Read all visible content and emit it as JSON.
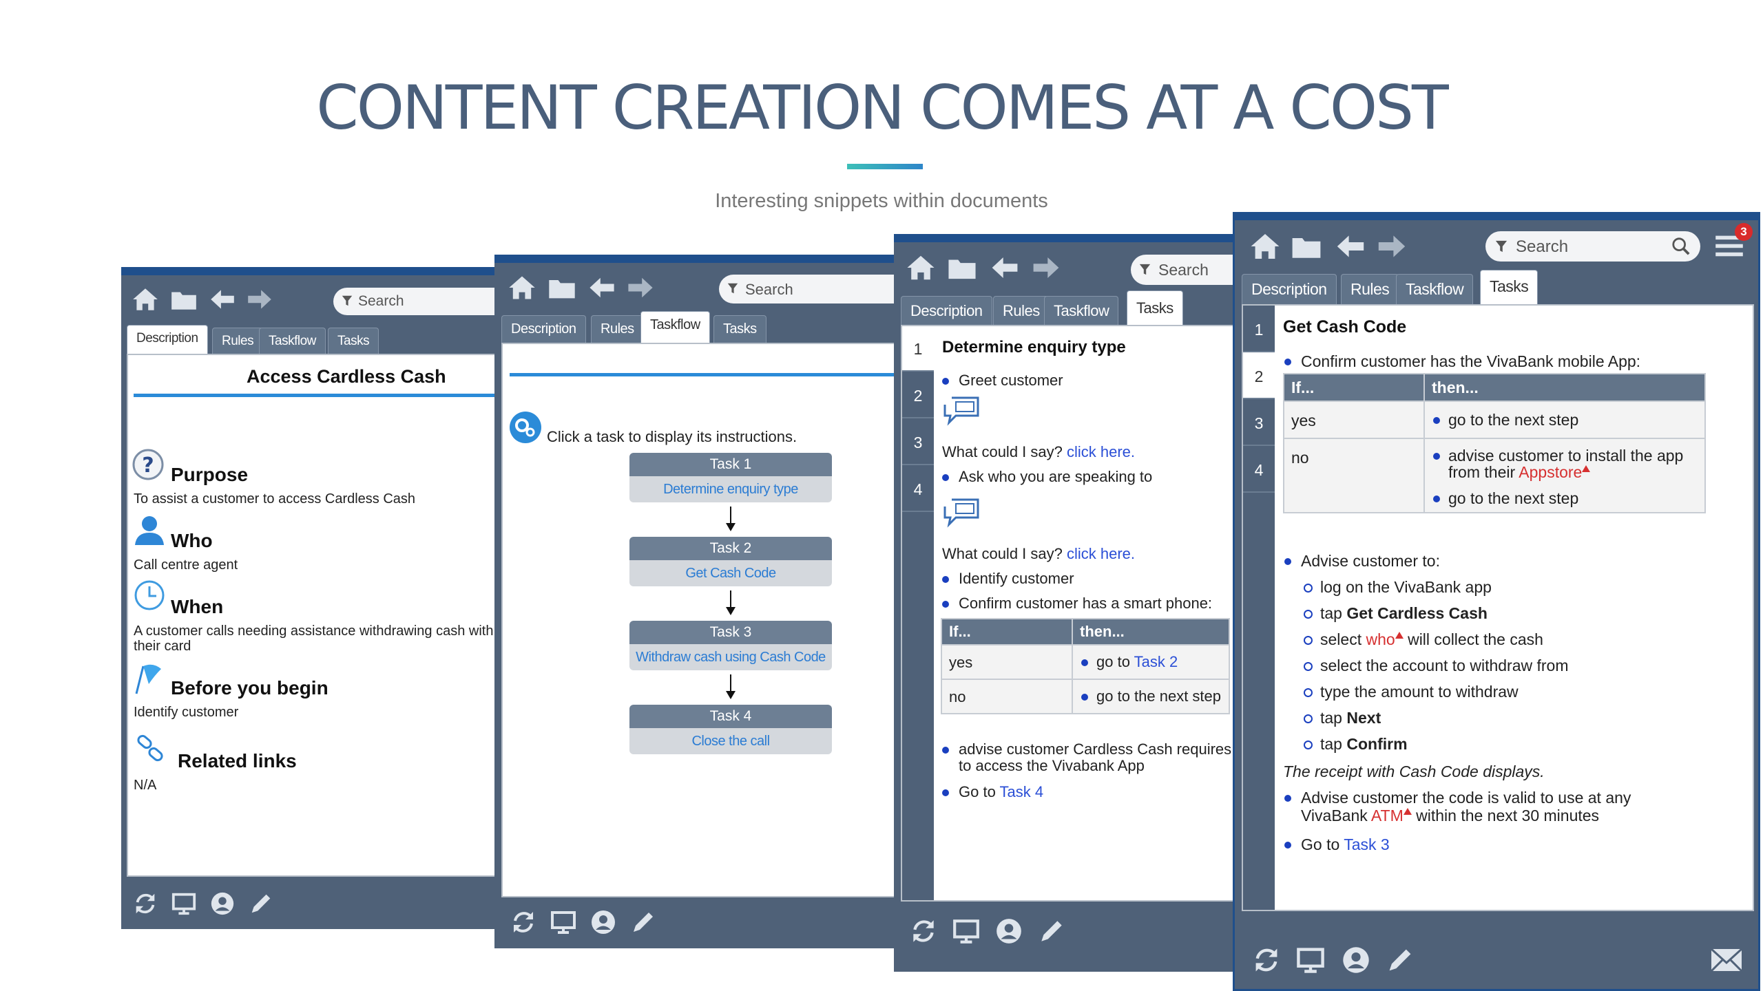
{
  "slide": {
    "title": "CONTENT CREATION COMES AT A COST",
    "subtitle": "Interesting snippets within documents"
  },
  "common": {
    "search_placeholder": "Search",
    "tabs": [
      "Description",
      "Rules",
      "Taskflow",
      "Tasks"
    ]
  },
  "panel_description": {
    "active_tab": "Description",
    "title": "Access Cardless Cash",
    "sections": [
      {
        "icon": "question-icon",
        "heading": "Purpose",
        "text": "To assist a customer to access Cardless Cash"
      },
      {
        "icon": "person-icon",
        "heading": "Who",
        "text": "Call centre agent"
      },
      {
        "icon": "clock-icon",
        "heading": "When",
        "text": "A customer calls needing assistance withdrawing cash with",
        "text2": "their card"
      },
      {
        "icon": "flag-icon",
        "heading": "Before you begin",
        "text": "Identify customer"
      },
      {
        "icon": "link-icon",
        "heading": "Related links",
        "text": "N/A"
      }
    ]
  },
  "panel_taskflow": {
    "active_tab": "Taskflow",
    "intro": "Click a task to display its instructions.",
    "tasks": [
      {
        "label": "Task 1",
        "link": "Determine enquiry type"
      },
      {
        "label": "Task 2",
        "link": "Get Cash Code"
      },
      {
        "label": "Task 3",
        "link": "Withdraw cash using Cash Code"
      },
      {
        "label": "Task 4",
        "link": "Close the call"
      }
    ]
  },
  "panel_tasks1": {
    "active_tab": "Tasks",
    "step_numbers": [
      "1",
      "2",
      "3",
      "4"
    ],
    "heading": "Determine enquiry type",
    "greet": "Greet customer",
    "say_prefix": "What could I say?",
    "say_link": "click here.",
    "ask": "Ask who you are speaking to",
    "identify": "Identify customer",
    "confirm": "Confirm customer has a smart phone:",
    "table": {
      "col_if": "If...",
      "col_then": "then...",
      "rows": [
        {
          "if": "yes",
          "then_prefix": "go to",
          "then_link": "Task 2"
        },
        {
          "if": "no",
          "then_prefix": "go to the next step",
          "then_link": ""
        }
      ]
    },
    "advise_line1": "advise customer Cardless Cash requires a",
    "advise_line2": "to access the Vivabank App",
    "goto_prefix": "Go to",
    "goto_link": "Task 4"
  },
  "panel_tasks2": {
    "active_tab": "Tasks",
    "notification_count": "3",
    "step_numbers": [
      "1",
      "2",
      "3",
      "4"
    ],
    "heading": "Get Cash Code",
    "confirm": "Confirm customer has the VivaBank mobile App:",
    "table": {
      "col_if": "If...",
      "col_then": "then...",
      "yes": "yes",
      "yes_then": "go to the next step",
      "no": "no",
      "no_then_1": "advise customer to install the app",
      "no_then_2_prefix": "from their",
      "no_then_2_link": "Appstore",
      "no_then_3": "go to the next step"
    },
    "advise": "Advise customer to:",
    "sub_items": [
      {
        "pre": "log on the VivaBank app",
        "bold": "",
        "red": "",
        "post": ""
      },
      {
        "pre": "tap ",
        "bold": "Get Cardless Cash",
        "red": "",
        "post": ""
      },
      {
        "pre": "select ",
        "bold": "",
        "red": "who",
        "post": " will collect the cash"
      },
      {
        "pre": "select the account to withdraw from",
        "bold": "",
        "red": "",
        "post": ""
      },
      {
        "pre": "type the amount to withdraw",
        "bold": "",
        "red": "",
        "post": ""
      },
      {
        "pre": "tap ",
        "bold": "Next",
        "red": "",
        "post": ""
      },
      {
        "pre": "tap ",
        "bold": "Confirm",
        "red": "",
        "post": ""
      }
    ],
    "receipt": "The receipt with Cash Code displays.",
    "code_line1": "Advise customer the code is valid to use at any",
    "code_line2_prefix": "VivaBank",
    "code_line2_link": "ATM",
    "code_line2_suffix": "within the next 30 minutes",
    "goto_prefix": "Go to",
    "goto_link": "Task 3"
  }
}
